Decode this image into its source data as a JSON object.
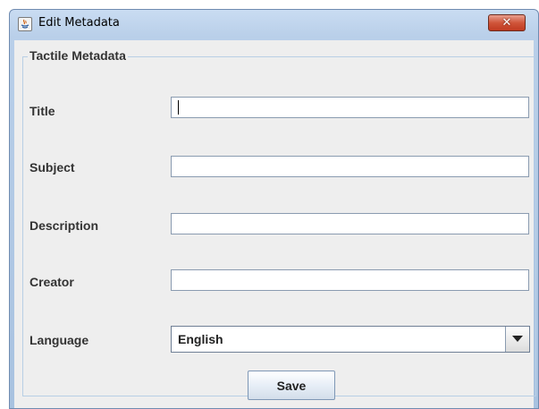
{
  "window": {
    "title": "Edit Metadata",
    "close_label": "✕",
    "app_icon": "java-icon"
  },
  "panel": {
    "legend": "Tactile Metadata",
    "fields": {
      "title": {
        "label": "Title",
        "value": ""
      },
      "subject": {
        "label": "Subject",
        "value": ""
      },
      "description": {
        "label": "Description",
        "value": ""
      },
      "creator": {
        "label": "Creator",
        "value": ""
      },
      "language": {
        "label": "Language",
        "value": "English"
      }
    },
    "save_label": "Save"
  }
}
